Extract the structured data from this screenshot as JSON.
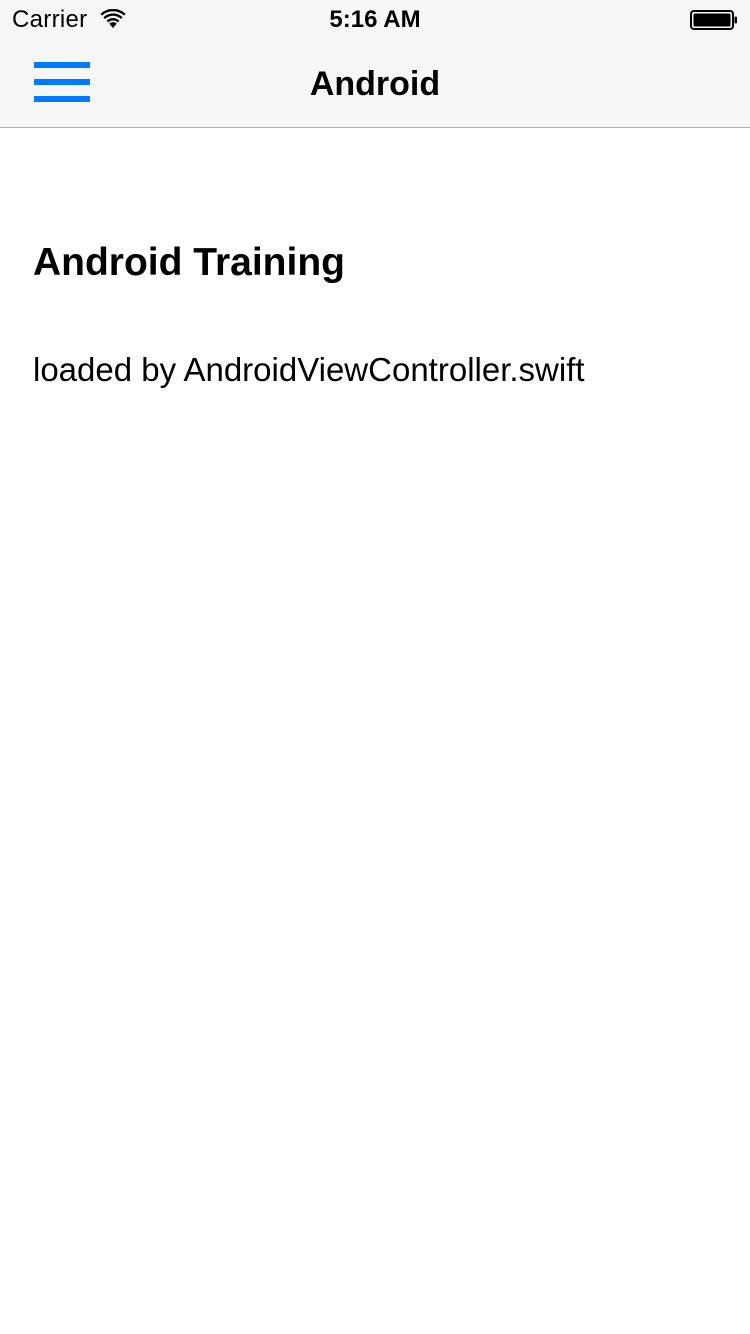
{
  "status_bar": {
    "carrier": "Carrier",
    "time": "5:16 AM",
    "wifi_icon": "wifi-icon",
    "battery_icon": "battery-full-icon",
    "battery_level": 1.0
  },
  "nav_bar": {
    "title": "Android",
    "menu_icon": "hamburger-menu-icon"
  },
  "main": {
    "heading": "Android Training",
    "subtext": "loaded by AndroidViewController.swift"
  },
  "colors": {
    "accent": "#007aff",
    "nav_background": "#f7f7f7",
    "background": "#ffffff"
  }
}
